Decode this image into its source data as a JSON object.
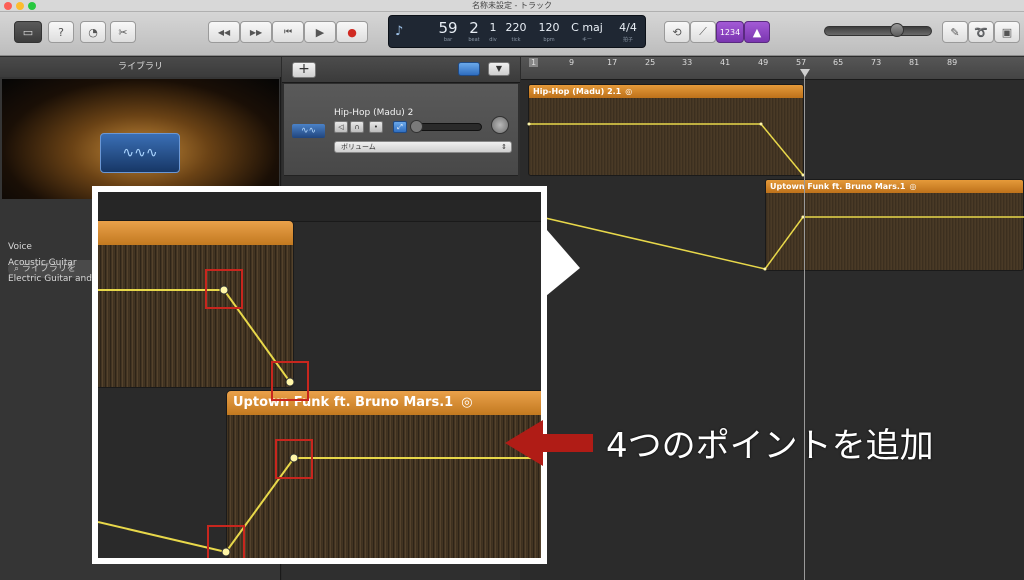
{
  "window": {
    "title": "名称未設定 - トラック"
  },
  "toolbar": {
    "help_label": "?",
    "rewind_label": "◀◀",
    "forward_label": "▶▶",
    "to_start_label": "⏮",
    "play_label": "▶",
    "record_label": "●",
    "count_in_label": "1234"
  },
  "lcd": {
    "bar": "59",
    "beat": "2",
    "div": "1",
    "tick": "220",
    "tempo": "120",
    "key": "C maj",
    "signature": "4/4",
    "bar_label": "bar",
    "beat_label": "beat",
    "div_label": "div",
    "tick_label": "tick",
    "tempo_label": "bpm",
    "key_label": "キー",
    "sig_label": "拍子"
  },
  "library": {
    "header": "ライブラリ",
    "search_placeholder": "ライブラリを",
    "categories": [
      "Voice",
      "Acoustic Guitar",
      "Electric Guitar and"
    ]
  },
  "track": {
    "name": "Hip-Hop (Madu) 2",
    "automation_label": "ボリューム",
    "add_label": "+"
  },
  "ruler": {
    "ticks": [
      "1",
      "9",
      "17",
      "25",
      "33",
      "41",
      "49",
      "57",
      "65",
      "73",
      "81",
      "89"
    ]
  },
  "regions": {
    "first_name": "Hip-Hop (Madu) 2.1",
    "second_name": "Uptown Funk ft. Bruno Mars.1"
  },
  "annotation": {
    "text": "4つのポイントを追加"
  },
  "colors": {
    "region_orange": "#d9892b",
    "automation_line": "#e8d84a",
    "highlight_box": "#c8261e",
    "annotation_arrow": "#b01c16"
  }
}
